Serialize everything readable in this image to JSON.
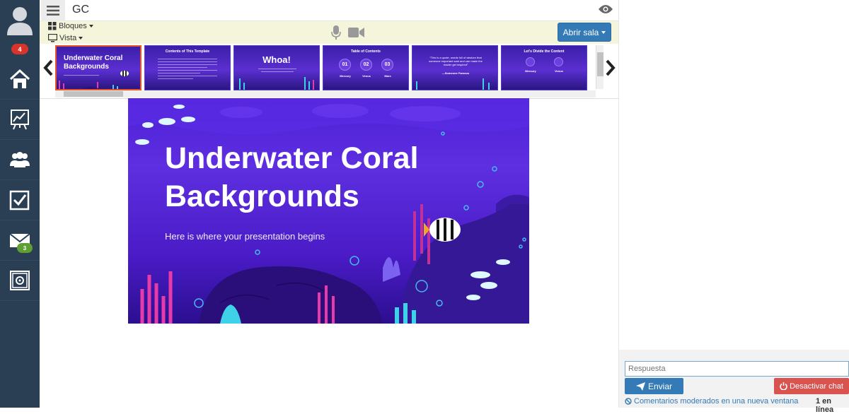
{
  "sidebar": {
    "notifications_count": "4",
    "messages_count": "3",
    "items": [
      {
        "icon": "home-icon"
      },
      {
        "icon": "chart-board-icon"
      },
      {
        "icon": "users-icon"
      },
      {
        "icon": "checkbox-icon"
      },
      {
        "icon": "mail-icon"
      },
      {
        "icon": "safe-icon"
      }
    ]
  },
  "header": {
    "room_title": "GC"
  },
  "toolbar": {
    "bloques_label": "Bloques",
    "vista_label": "Vista",
    "open_room_label": "Abrir sala"
  },
  "thumbnails": [
    {
      "title": "Underwater Coral Backgrounds",
      "active": true
    },
    {
      "title": "Contents of This Template"
    },
    {
      "title": "Whoa!"
    },
    {
      "title": "Table of Contents",
      "numbers": [
        "01",
        "02",
        "03"
      ],
      "labels": [
        "Mercury",
        "Venus",
        "Mars"
      ]
    },
    {
      "title": "“This is a quote, words full of wisdom that someone important said and can make the reader get inspired”",
      "author": "—Someone Famous"
    },
    {
      "title": "Let's Divide the Content",
      "labels": [
        "Mercury",
        "Venus"
      ]
    }
  ],
  "slide": {
    "title": "Underwater Coral Backgrounds",
    "subtitle": "Here is where your presentation begins"
  },
  "chat": {
    "reply_placeholder": "Respuesta",
    "send_label": "Enviar",
    "disable_label": "Desactivar chat",
    "moderated_label": "Comentarios moderados en una nueva ventana",
    "online_label": "1 en línea"
  },
  "colors": {
    "sidebar_bg": "#2a3f54",
    "toolbar_bg": "#f5f5dc",
    "primary": "#337ab7",
    "danger": "#d9534f",
    "slide_purple": "#5d2fe0"
  }
}
